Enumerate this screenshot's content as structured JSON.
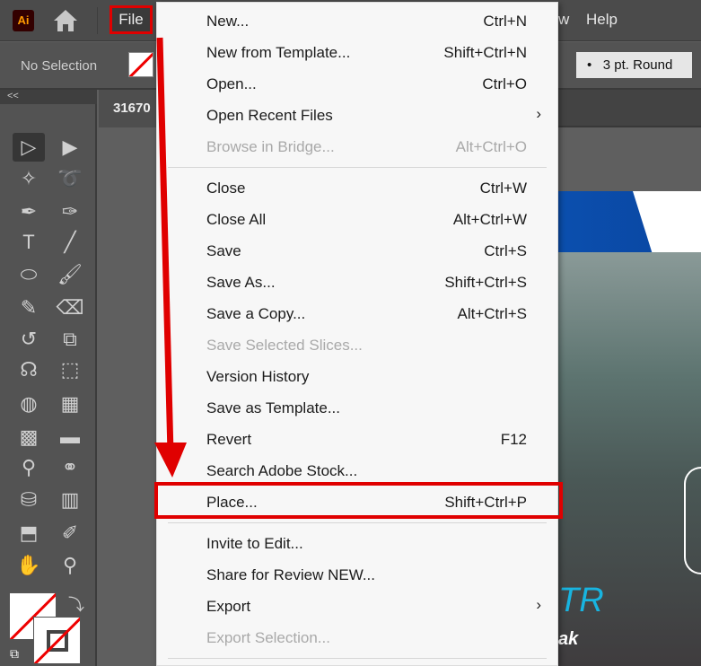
{
  "app": {
    "logo": "Ai",
    "home_icon": "home-icon"
  },
  "menubar": {
    "file": "File",
    "view_partial": "w",
    "help": "Help"
  },
  "control": {
    "selection": "No Selection",
    "stroke_profile": "3 pt. Round"
  },
  "document": {
    "tab": "31670"
  },
  "toolbar": {
    "collapse": "<<",
    "tools": [
      [
        "selection",
        "▷"
      ],
      [
        "direct-selection",
        "▶"
      ],
      [
        "magic-wand",
        "✧"
      ],
      [
        "lasso",
        "➰"
      ],
      [
        "pen",
        "✒"
      ],
      [
        "curvature",
        "✑"
      ],
      [
        "type",
        "T"
      ],
      [
        "line",
        "╱"
      ],
      [
        "ellipse",
        "⬭"
      ],
      [
        "paintbrush",
        "🖌"
      ],
      [
        "shaper",
        "✎"
      ],
      [
        "eraser",
        "⌫"
      ],
      [
        "rotate",
        "↺"
      ],
      [
        "scale",
        "⧉"
      ],
      [
        "warp",
        "☊"
      ],
      [
        "free-transform",
        "⬚"
      ],
      [
        "shape-builder",
        "◍"
      ],
      [
        "perspective-grid",
        "▦"
      ],
      [
        "mesh",
        "▩"
      ],
      [
        "gradient",
        "▬"
      ],
      [
        "eyedropper",
        "⚲"
      ],
      [
        "blend",
        "⚭"
      ],
      [
        "symbol-sprayer",
        "⛁"
      ],
      [
        "column-graph",
        "▥"
      ],
      [
        "artboard",
        "⬒"
      ],
      [
        "slice",
        "✐"
      ],
      [
        "hand",
        "✋"
      ],
      [
        "zoom",
        "⚲"
      ]
    ]
  },
  "artwork": {
    "title_fragment": "TR",
    "subtitle_fragment": "ak"
  },
  "file_menu": [
    {
      "label": "New...",
      "shortcut": "Ctrl+N"
    },
    {
      "label": "New from Template...",
      "shortcut": "Shift+Ctrl+N"
    },
    {
      "label": "Open...",
      "shortcut": "Ctrl+O"
    },
    {
      "label": "Open Recent Files",
      "submenu": true
    },
    {
      "label": "Browse in Bridge...",
      "shortcut": "Alt+Ctrl+O",
      "disabled": true
    },
    {
      "sep": true
    },
    {
      "label": "Close",
      "shortcut": "Ctrl+W"
    },
    {
      "label": "Close All",
      "shortcut": "Alt+Ctrl+W"
    },
    {
      "label": "Save",
      "shortcut": "Ctrl+S"
    },
    {
      "label": "Save As...",
      "shortcut": "Shift+Ctrl+S"
    },
    {
      "label": "Save a Copy...",
      "shortcut": "Alt+Ctrl+S"
    },
    {
      "label": "Save Selected Slices...",
      "disabled": true
    },
    {
      "label": "Version History"
    },
    {
      "label": "Save as Template..."
    },
    {
      "label": "Revert",
      "shortcut": "F12"
    },
    {
      "label": "Search Adobe Stock..."
    },
    {
      "label": "Place...",
      "shortcut": "Shift+Ctrl+P",
      "highlighted": true
    },
    {
      "sep": true
    },
    {
      "label": "Invite to Edit..."
    },
    {
      "label": "Share for Review NEW..."
    },
    {
      "label": "Export",
      "submenu": true
    },
    {
      "label": "Export Selection...",
      "disabled": true
    },
    {
      "sep": true
    }
  ],
  "colors": {
    "annotation": "#e00000",
    "accent_text": "#18b4e0"
  }
}
